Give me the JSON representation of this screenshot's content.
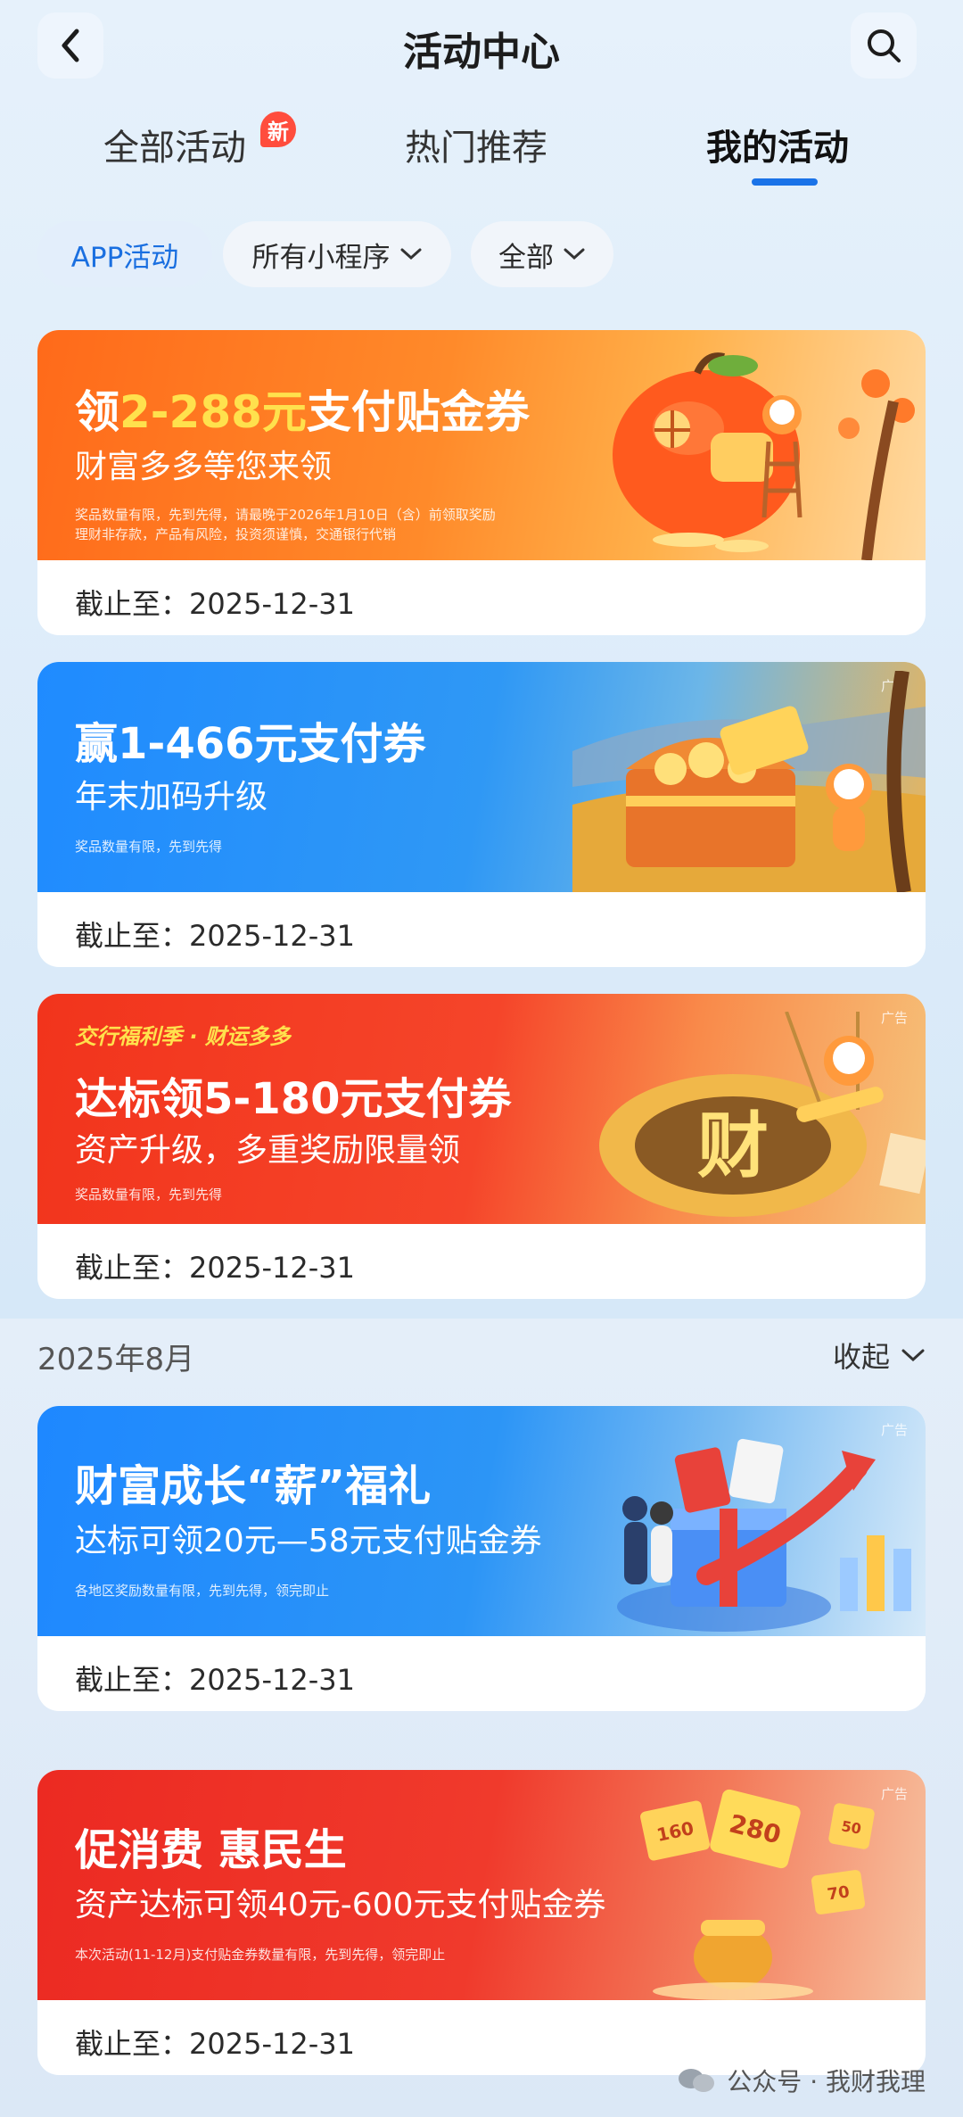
{
  "header": {
    "title": "活动中心"
  },
  "tabs": [
    {
      "label": "全部活动",
      "badge": "新"
    },
    {
      "label": "热门推荐"
    },
    {
      "label": "我的活动"
    }
  ],
  "filters": {
    "channel": "APP活动",
    "mini_program": "所有小程序",
    "status": "全部"
  },
  "cards": [
    {
      "headline_pre": "领",
      "headline_highlight": "2-288元",
      "headline_post": "支付贴金券",
      "sub": "财富多多等您来领",
      "fine1": "奖品数量有限，先到先得，请最晚于2026年1月10日（含）前领取奖励",
      "fine2": "理财非存款，产品有风险，投资须谨慎，交通银行代销",
      "deadline": "截止至：2025-12-31"
    },
    {
      "ad": "广告",
      "headline": "赢1-466元支付券",
      "sub": "年末加码升级",
      "fine1": "奖品数量有限，先到先得",
      "deadline": "截止至：2025-12-31"
    },
    {
      "ad": "广告",
      "kicker": "交行福利季 · 财运多多",
      "headline": "达标领5-180元支付券",
      "sub": "资产升级，多重奖励限量领",
      "fine1": "奖品数量有限，先到先得",
      "art_char": "财",
      "deadline": "截止至：2025-12-31"
    }
  ],
  "section": {
    "title": "2025年8月",
    "toggle": "收起"
  },
  "section_cards": [
    {
      "ad": "广告",
      "headline": "财富成长“薪”福礼",
      "sub": "达标可领20元—58元支付贴金券",
      "fine1": "各地区奖励数量有限，先到先得，领完即止",
      "deadline": "截止至：2025-12-31"
    },
    {
      "ad": "广告",
      "headline": "促消费 惠民生",
      "sub": "资产达标可领40元-600元支付贴金券",
      "fine1": "本次活动(11-12月)支付贴金券数量有限，先到先得，领完即止",
      "coupons": [
        "160",
        "280",
        "50",
        "70"
      ],
      "deadline": "截止至：2025-12-31"
    }
  ],
  "watermark": "公众号 · 我财我理",
  "colors": {
    "accent": "#1a73e8",
    "badge": "#ff4d3d",
    "highlight": "#ffe14d"
  }
}
